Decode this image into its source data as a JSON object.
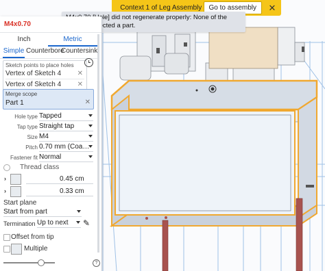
{
  "banner": {
    "text": "Context 1 of Leg Assembly",
    "goto_label": "Go to assembly",
    "close_glyph": "✕"
  },
  "tooltip": {
    "text": "M4x0.70 [Hole] did not regenerate properly: None of the holes intersected a part."
  },
  "dialog": {
    "title": "M4x0.70",
    "unit_tabs": [
      "Inch",
      "Metric"
    ],
    "active_unit": "Metric",
    "type_tabs": [
      "Simple",
      "Counterbore",
      "Countersink"
    ],
    "active_type": "Simple",
    "sketch_points": {
      "label": "Sketch points to place holes",
      "items": [
        "Vertex of Sketch 4",
        "Vertex of Sketch 4"
      ]
    },
    "merge_scope": {
      "label": "Merge scope",
      "value": "Part 1"
    },
    "fields": {
      "hole_type": {
        "label": "Hole type",
        "value": "Tapped"
      },
      "tap_type": {
        "label": "Tap type",
        "value": "Straight tap"
      },
      "size": {
        "label": "Size",
        "value": "M4"
      },
      "pitch": {
        "label": "Pitch",
        "value": "0.70 mm (Coa…"
      },
      "fastener_fit": {
        "label": "Fastener fit",
        "value": "Normal"
      }
    },
    "thread_class": "Thread class",
    "tap_drill_diameter": "0.45 cm",
    "thread_diameter": "0.33 cm",
    "start_plane": {
      "label": "Start plane",
      "value": "Start from part"
    },
    "termination": {
      "label": "Termination",
      "value": "Up to next"
    },
    "offset_from_tip": "Offset from tip",
    "multiple": "Multiple"
  },
  "colors": {
    "banner": "#f5c518",
    "accent": "#1a66cc",
    "error": "#d93025",
    "selection": "#f0a830",
    "leg": "#a8534f"
  }
}
